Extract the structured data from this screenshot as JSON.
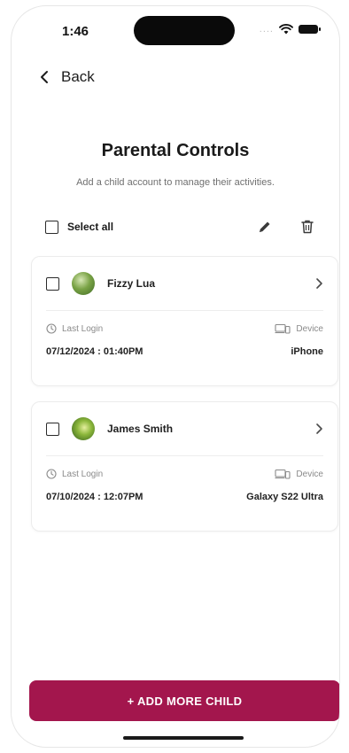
{
  "status_bar": {
    "time": "1:46",
    "signal": "....",
    "icons": [
      "wifi-icon",
      "battery-icon"
    ]
  },
  "nav": {
    "back_label": "Back",
    "icon": "chevron-left-icon"
  },
  "header": {
    "title": "Parental Controls",
    "subtitle": "Add a child account to manage their activities."
  },
  "toolbar": {
    "select_all_label": "Select all",
    "edit_icon": "pencil-icon",
    "delete_icon": "trash-icon"
  },
  "children": [
    {
      "name": "Fizzy Lua",
      "last_login_label": "Last Login",
      "last_login_value": "07/12/2024 : 01:40PM",
      "device_label": "Device",
      "device_value": "iPhone"
    },
    {
      "name": "James Smith",
      "last_login_label": "Last Login",
      "last_login_value": "07/10/2024 : 12:07PM",
      "device_label": "Device",
      "device_value": "Galaxy S22 Ultra"
    }
  ],
  "actions": {
    "add_child_label": "+ ADD MORE CHILD"
  },
  "colors": {
    "accent": "#a3164d",
    "text": "#1f1f1f",
    "muted": "#8a8a8a"
  }
}
